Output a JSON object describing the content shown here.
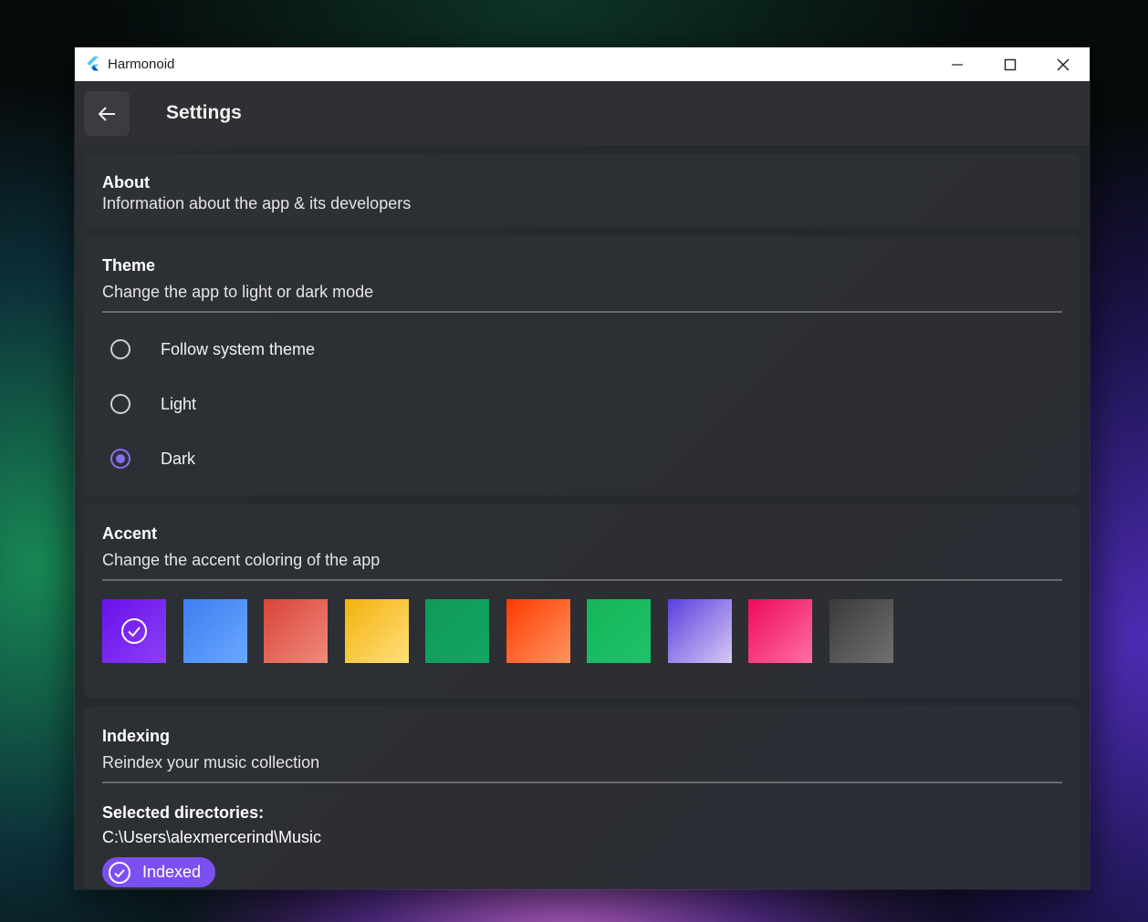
{
  "window": {
    "title": "Harmonoid"
  },
  "header": {
    "title": "Settings"
  },
  "about": {
    "title": "About",
    "subtitle": "Information about the app & its developers"
  },
  "theme": {
    "title": "Theme",
    "subtitle": "Change the app to light or dark mode",
    "options": [
      {
        "label": "Follow system theme",
        "selected": false
      },
      {
        "label": "Light",
        "selected": false
      },
      {
        "label": "Dark",
        "selected": true
      }
    ]
  },
  "accent": {
    "title": "Accent",
    "subtitle": "Change the accent coloring of the app",
    "swatches": [
      {
        "from": "#6a12ec",
        "to": "#8b3ff4",
        "selected": true
      },
      {
        "from": "#3d7ef0",
        "to": "#6aa8ff",
        "selected": false
      },
      {
        "from": "#d9433a",
        "to": "#f08a7a",
        "selected": false
      },
      {
        "from": "#f2b10e",
        "to": "#ffe07a",
        "selected": false
      },
      {
        "from": "#0f9a5a",
        "to": "#14a563",
        "selected": false
      },
      {
        "from": "#ff3b00",
        "to": "#ff9560",
        "selected": false
      },
      {
        "from": "#16b45a",
        "to": "#1fc26a",
        "selected": false
      },
      {
        "from": "#5a3fe0",
        "to": "#d8c8f4",
        "selected": false
      },
      {
        "from": "#ee0a5a",
        "to": "#ff6fa6",
        "selected": false
      },
      {
        "from": "#3a3a3a",
        "to": "#707070",
        "selected": false
      }
    ]
  },
  "indexing": {
    "title": "Indexing",
    "subtitle": "Reindex your music collection",
    "selected_label": "Selected directories:",
    "directory": "C:\\Users\\alexmercerind\\Music",
    "chip_label": "Indexed"
  },
  "colors": {
    "accent": "#7c4ff0",
    "radio_selected": "#8a6cf0"
  }
}
